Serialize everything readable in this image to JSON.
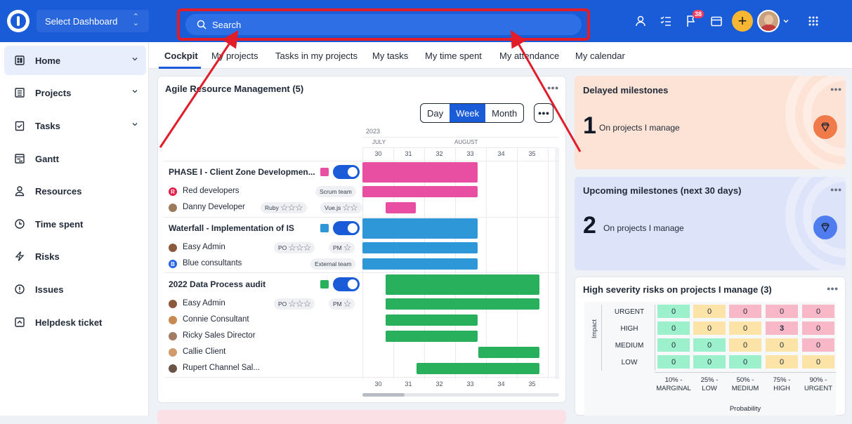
{
  "topbar": {
    "dashboard_select": "Select Dashboard",
    "search_placeholder": "Search",
    "notifications_count": "38"
  },
  "sidebar": {
    "items": [
      {
        "label": "Home",
        "icon": "home-icon"
      },
      {
        "label": "Projects",
        "icon": "projects-icon"
      },
      {
        "label": "Tasks",
        "icon": "tasks-icon"
      },
      {
        "label": "Gantt",
        "icon": "gantt-icon"
      },
      {
        "label": "Resources",
        "icon": "resources-icon"
      },
      {
        "label": "Time spent",
        "icon": "clock-icon"
      },
      {
        "label": "Risks",
        "icon": "risks-icon"
      },
      {
        "label": "Issues",
        "icon": "issues-icon"
      },
      {
        "label": "Helpdesk ticket",
        "icon": "helpdesk-icon"
      }
    ]
  },
  "tabs": [
    "Cockpit",
    "My projects",
    "Tasks in my projects",
    "My tasks",
    "My time spent",
    "My attendance",
    "My calendar"
  ],
  "resource_card": {
    "title": "Agile Resource Management (5)",
    "views": [
      "Day",
      "Week",
      "Month"
    ],
    "year": "2023",
    "months": [
      "JULY",
      "AUGUST"
    ],
    "weeks": [
      "30",
      "31",
      "32",
      "33",
      "34",
      "35"
    ],
    "projects": [
      {
        "name": "PHASE I - Client Zone Developmen...",
        "color": "#e84fa3",
        "rows": [
          {
            "name": "Red developers",
            "tags": [
              "Scrum team"
            ]
          },
          {
            "name": "Danny Developer",
            "tags": [
              "Ruby",
              "Vue.js"
            ]
          }
        ]
      },
      {
        "name": "Waterfall - Implementation of IS",
        "color": "#2d97d8",
        "rows": [
          {
            "name": "Easy Admin",
            "tags": [
              "PO",
              "PM"
            ]
          },
          {
            "name": "Blue consultants",
            "tags": [
              "External team"
            ]
          }
        ]
      },
      {
        "name": "2022 Data Process audit",
        "color": "#28b05c",
        "rows": [
          {
            "name": "Easy Admin",
            "tags": [
              "PO",
              "PM"
            ]
          },
          {
            "name": "Connie Consultant",
            "tags": []
          },
          {
            "name": "Ricky Sales Director",
            "tags": []
          },
          {
            "name": "Callie Client",
            "tags": []
          },
          {
            "name": "Rupert Channel Sal...",
            "tags": []
          }
        ]
      }
    ]
  },
  "delayed": {
    "title": "Delayed milestones",
    "count": "1",
    "text": "On projects I manage",
    "color": "#fde3d6"
  },
  "upcoming": {
    "title": "Upcoming milestones (next 30 days)",
    "count": "2",
    "text": "On projects I manage",
    "color": "#dde3f9"
  },
  "risks": {
    "title": "High severity risks on projects I manage (3)",
    "impact_label": "Impact",
    "impact_levels": [
      "URGENT",
      "HIGH",
      "MEDIUM",
      "LOW"
    ],
    "probability_levels": [
      "10% - MARGINAL",
      "25% - LOW",
      "50% - MEDIUM",
      "75% - HIGH",
      "90% - URGENT"
    ],
    "probability_label": "Probability",
    "matrix": [
      [
        "0",
        "0",
        "0",
        "0",
        "0"
      ],
      [
        "0",
        "0",
        "0",
        "3",
        "0"
      ],
      [
        "0",
        "0",
        "0",
        "0",
        "0"
      ],
      [
        "0",
        "0",
        "0",
        "0",
        "0"
      ]
    ]
  }
}
